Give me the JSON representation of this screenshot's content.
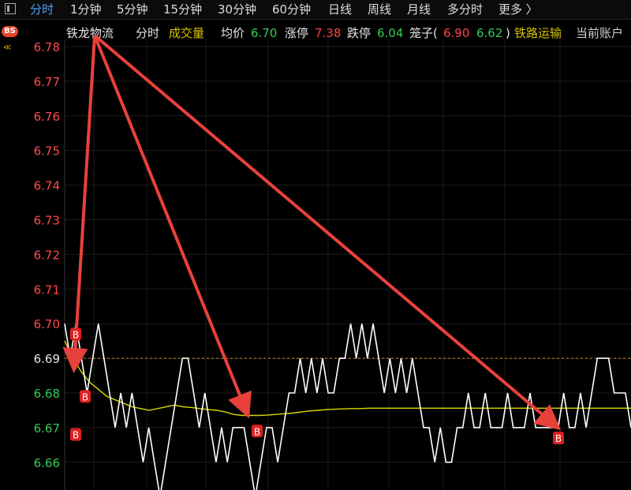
{
  "tabs": [
    {
      "label": "分时",
      "active": true
    },
    {
      "label": "1分钟"
    },
    {
      "label": "5分钟"
    },
    {
      "label": "15分钟"
    },
    {
      "label": "30分钟"
    },
    {
      "label": "60分钟"
    },
    {
      "label": "日线"
    },
    {
      "label": "周线"
    },
    {
      "label": "月线"
    },
    {
      "label": "多分时"
    },
    {
      "label": "更多 〉"
    }
  ],
  "info": {
    "badge": "BS",
    "stock_name": "铁龙物流",
    "mode": "分时",
    "volume_label": "成交量",
    "avg_label": "均价",
    "avg_value": "6.70",
    "limit_up_label": "涨停",
    "limit_up_value": "7.38",
    "limit_down_label": "跌停",
    "limit_down_value": "6.04",
    "cage_label": "笼子(",
    "cage_high": "6.90",
    "cage_low": "6.62",
    "cage_close": ")",
    "sector": "铁路运输",
    "account": "当前账户"
  },
  "chart_data": {
    "type": "line",
    "y_ticks": [
      "6.78",
      "6.77",
      "6.76",
      "6.75",
      "6.74",
      "6.73",
      "6.72",
      "6.71",
      "6.70",
      "6.69",
      "6.68",
      "6.67",
      "6.66"
    ],
    "ylim": [
      6.655,
      6.785
    ],
    "reference_price": 6.69,
    "series": [
      {
        "role": "price",
        "color": "#ffffff",
        "values": [
          6.7,
          6.69,
          6.7,
          6.69,
          6.68,
          6.69,
          6.7,
          6.69,
          6.68,
          6.67,
          6.68,
          6.67,
          6.68,
          6.67,
          6.66,
          6.67,
          6.66,
          6.65,
          6.66,
          6.67,
          6.68,
          6.69,
          6.69,
          6.68,
          6.67,
          6.68,
          6.67,
          6.66,
          6.67,
          6.66,
          6.67,
          6.67,
          6.67,
          6.66,
          6.65,
          6.66,
          6.67,
          6.67,
          6.66,
          6.67,
          6.68,
          6.68,
          6.69,
          6.68,
          6.69,
          6.68,
          6.69,
          6.68,
          6.68,
          6.69,
          6.69,
          6.7,
          6.69,
          6.7,
          6.69,
          6.7,
          6.69,
          6.68,
          6.69,
          6.68,
          6.69,
          6.68,
          6.69,
          6.68,
          6.67,
          6.67,
          6.66,
          6.67,
          6.66,
          6.66,
          6.67,
          6.67,
          6.68,
          6.67,
          6.67,
          6.68,
          6.67,
          6.67,
          6.67,
          6.68,
          6.67,
          6.67,
          6.67,
          6.68,
          6.67,
          6.67,
          6.67,
          6.67,
          6.67,
          6.68,
          6.67,
          6.67,
          6.68,
          6.67,
          6.68,
          6.69,
          6.69,
          6.69,
          6.68,
          6.68,
          6.68,
          6.67
        ]
      },
      {
        "role": "average",
        "color": "#d9d900",
        "values": [
          6.695,
          6.69,
          6.686,
          6.683,
          6.681,
          6.679,
          6.678,
          6.677,
          6.676,
          6.6755,
          6.675,
          6.6755,
          6.676,
          6.6765,
          6.676,
          6.6758,
          6.6755,
          6.6752,
          6.675,
          6.6745,
          6.6738,
          6.6735,
          6.6735,
          6.6735,
          6.6736,
          6.6738,
          6.674,
          6.6742,
          6.6745,
          6.6748,
          6.675,
          6.6752,
          6.6753,
          6.6754,
          6.6755,
          6.6755,
          6.6756,
          6.6756,
          6.6756,
          6.6756,
          6.6756,
          6.6756,
          6.6756,
          6.6756,
          6.6756,
          6.6756,
          6.6756,
          6.6756,
          6.6756,
          6.6756,
          6.6756,
          6.6756,
          6.6756,
          6.6756,
          6.6756,
          6.6756,
          6.6756,
          6.6756,
          6.6756,
          6.6756,
          6.6756,
          6.6756,
          6.6756,
          6.6756,
          6.6756,
          6.6756,
          6.6756,
          6.6756
        ]
      }
    ],
    "markers": [
      {
        "label": "B",
        "color": "#e02020",
        "price": 6.697
      },
      {
        "label": "B",
        "color": "#e02020",
        "price": 6.679
      },
      {
        "label": "B",
        "color": "#e02020",
        "price": 6.668
      },
      {
        "label": "B",
        "color": "#e02020",
        "price": 6.669
      },
      {
        "label": "B",
        "color": "#e02020",
        "price": 6.667
      }
    ],
    "arrows_color": "#e8413c"
  }
}
